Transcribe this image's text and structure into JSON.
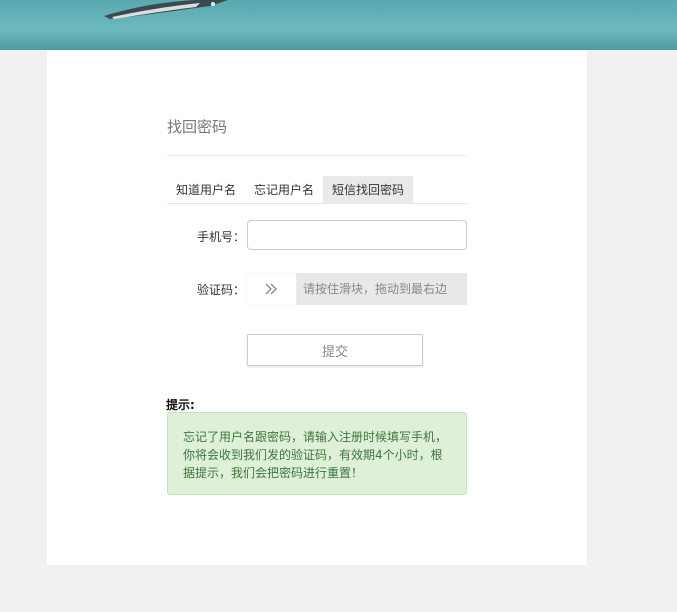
{
  "page": {
    "title": "找回密码"
  },
  "tabs": [
    {
      "label": "知道用户名",
      "active": false
    },
    {
      "label": "忘记用户名",
      "active": false
    },
    {
      "label": "短信找回密码",
      "active": true
    }
  ],
  "form": {
    "phone_label": "手机号：",
    "phone_value": "",
    "phone_placeholder": "",
    "captcha_label": "验证码：",
    "slider_handle_icon": "double-chevron-right-icon",
    "slider_text": "请按住滑块，拖动到最右边",
    "submit_label": "提交"
  },
  "hint": {
    "label": "提示:",
    "text": "忘记了用户名跟密码，请输入注册时候填写手机，你将会收到我们发的验证码，有效期4个小时，根据提示，我们会把密码进行重置！"
  },
  "colors": {
    "background": "#f1f1f1",
    "card": "#ffffff",
    "banner": "#5aa9b0",
    "active_tab": "#eaeaea",
    "hint_bg": "#dff0d8",
    "hint_text": "#3c763d"
  }
}
